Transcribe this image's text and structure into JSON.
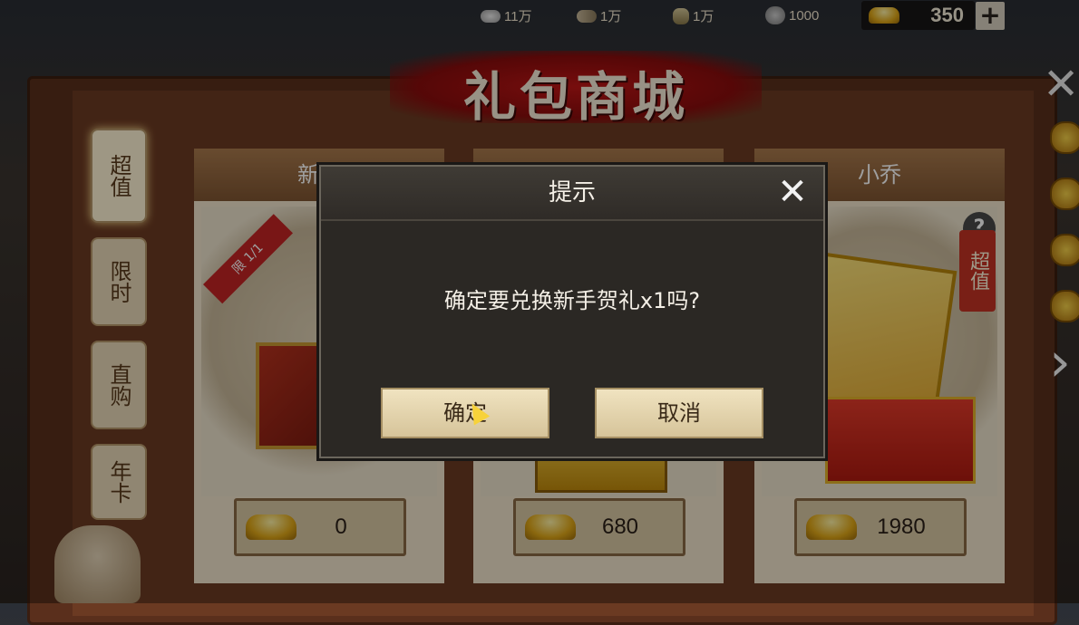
{
  "resources": [
    {
      "icon": "silver-ingot-icon",
      "value": "11万"
    },
    {
      "icon": "wood-icon",
      "value": "1万"
    },
    {
      "icon": "grain-icon",
      "value": "1万"
    },
    {
      "icon": "stone-icon",
      "value": "1000"
    }
  ],
  "gold": {
    "value": "350",
    "plus": "+"
  },
  "title": "礼包商城",
  "tabs": [
    {
      "label": "超值",
      "active": true
    },
    {
      "label": "限时"
    },
    {
      "label": "直购"
    },
    {
      "label": "年卡"
    }
  ],
  "cards": [
    {
      "name": "新手",
      "price": "0",
      "ribbon": "限 1/1"
    },
    {
      "name": "",
      "price": "680"
    },
    {
      "name": "小乔",
      "price": "1980",
      "badge": "超值",
      "help": "?"
    }
  ],
  "dialog": {
    "title": "提示",
    "close": "✕",
    "message": "确定要兑换新手贺礼x1吗?",
    "confirm": "确定",
    "cancel": "取消"
  },
  "colors": {
    "accent_red": "#c01616",
    "gold": "#e0a818",
    "dialog_bg": "#2b2824"
  }
}
